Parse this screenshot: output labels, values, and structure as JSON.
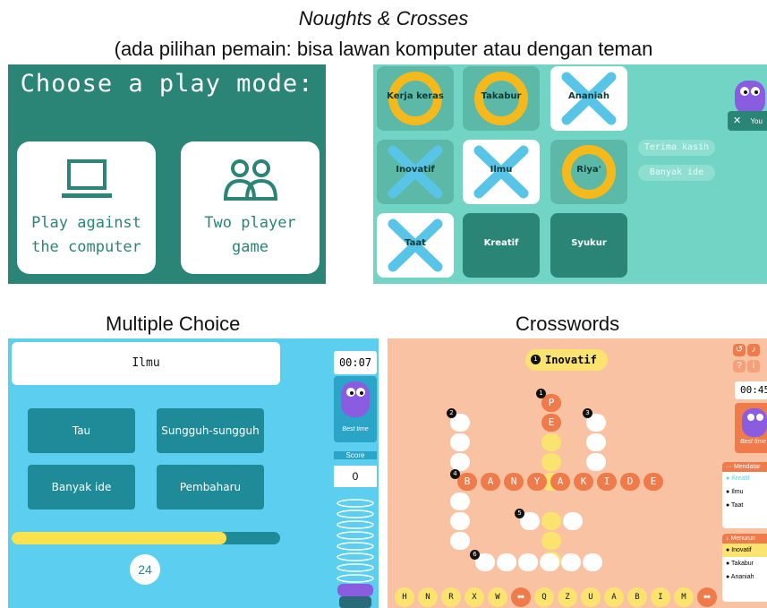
{
  "headings": {
    "title": "Noughts & Crosses",
    "subtitle": "(ada pilihan pemain: bisa lawan komputer atau dengan teman",
    "mc": "Multiple Choice",
    "cw": "Crosswords"
  },
  "playmode": {
    "title": "Choose a play mode:",
    "computer_line1": "Play against",
    "computer_line2": "the computer",
    "two_line1": "Two player",
    "two_line2": "game"
  },
  "ttt": {
    "cells": [
      "Kerja keras",
      "Takabur",
      "Ananiah",
      "Inovatif",
      "Ilmu",
      "Riya'",
      "Taat",
      "Kreatif",
      "Syukur"
    ],
    "marks": [
      "O",
      "O",
      "X",
      "X",
      "X",
      "O",
      "X",
      "",
      ""
    ],
    "chips": [
      "Terima kasih",
      "Banyak ide"
    ],
    "you_label": "You",
    "close_label": "✕"
  },
  "mc": {
    "question": "Ilmu",
    "options": [
      "Tau",
      "Sungguh-sungguh",
      "Banyak ide",
      "Pembaharu"
    ],
    "timer": "00:07",
    "best_time": "Best time",
    "score_label": "Score",
    "score_value": "0",
    "progress": 0.8,
    "count": "24"
  },
  "cw": {
    "clue_number": "1",
    "clue": "Inovatif",
    "timer": "00:45",
    "best_time": "Best time",
    "across_header": "··· Mendatar",
    "down_header": "↓ Menurun",
    "across_items": [
      "Kreatif",
      "Ilmu",
      "Taat"
    ],
    "down_items": [
      "Inovatif",
      "Takabur",
      "Ananiah"
    ],
    "row4_letters": [
      "B",
      "A",
      "N",
      "Y",
      "A",
      "K",
      "I",
      "D",
      "E"
    ],
    "col1_letters": [
      "P",
      "E"
    ],
    "clue_numbers": [
      "1",
      "2",
      "3",
      "4",
      "5",
      "6"
    ],
    "keyboard": [
      "H",
      "N",
      "R",
      "X",
      "W",
      "",
      "Q",
      "Z",
      "U",
      "A",
      "B",
      "I",
      "M",
      ""
    ]
  },
  "colors": {
    "teal_dark": "#2a8577",
    "teal_light": "#72d4c4",
    "cyan": "#5ccff0",
    "peach": "#f9c3a3",
    "yellow": "#fbe370",
    "orange": "#f07b4a",
    "x_blue": "#58c4e8",
    "o_gold": "#f5b91c",
    "monster_purple": "#8a5ce0"
  }
}
